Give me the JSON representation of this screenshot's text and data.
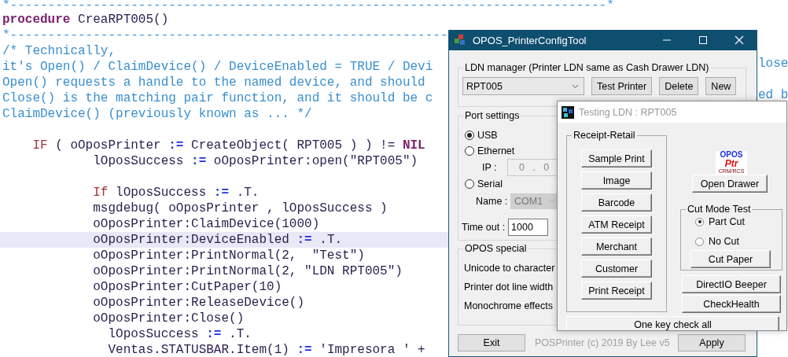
{
  "editor": {
    "lines": [
      {
        "current": false,
        "segments": [
          {
            "kind": "rule",
            "text": "*-------------------------------------------------------------------------------*"
          }
        ]
      },
      {
        "current": false,
        "segments": [
          {
            "kind": "keyword",
            "text": "procedure"
          },
          {
            "kind": "plain",
            "text": " CreaRPT005()"
          }
        ]
      },
      {
        "current": false,
        "segments": [
          {
            "kind": "rule",
            "text": "*----------------------------------------------------------"
          }
        ]
      },
      {
        "current": false,
        "segments": [
          {
            "kind": "comment",
            "text": "/* Technically,"
          }
        ]
      },
      {
        "current": false,
        "segments": [
          {
            "kind": "comment",
            "text": "it's Open() / ClaimDevice() / DeviceEnabled = TRUE / Devi"
          }
        ],
        "tail": "lose"
      },
      {
        "current": false,
        "segments": [
          {
            "kind": "comment",
            "text": "Open() requests a handle to the named device, and should"
          }
        ]
      },
      {
        "current": false,
        "segments": [
          {
            "kind": "comment",
            "text": "Close() is the matching pair function, and it should be c"
          }
        ],
        "tail": "ed b"
      },
      {
        "current": false,
        "segments": [
          {
            "kind": "comment",
            "text": "ClaimDevice() (previously known as ... */"
          }
        ]
      },
      {
        "current": false
      },
      {
        "current": false,
        "segments": [
          {
            "kind": "control",
            "text": "    IF"
          },
          {
            "kind": "plain",
            "text": " ( oOposPrinter "
          },
          {
            "kind": "operator",
            "text": ":="
          },
          {
            "kind": "plain",
            "text": " CreateObject( RPT005 ) ) != "
          },
          {
            "kind": "constant",
            "text": "NIL"
          }
        ]
      },
      {
        "current": false,
        "segments": [
          {
            "kind": "plain",
            "text": "            lOposSuccess "
          },
          {
            "kind": "operator",
            "text": ":="
          },
          {
            "kind": "plain",
            "text": " oOposPrinter:open(\"RPT005\")"
          }
        ]
      },
      {
        "current": false
      },
      {
        "current": false,
        "segments": [
          {
            "kind": "control",
            "text": "            If"
          },
          {
            "kind": "plain",
            "text": " lOposSuccess "
          },
          {
            "kind": "operator",
            "text": ":="
          },
          {
            "kind": "plain",
            "text": " .T."
          }
        ]
      },
      {
        "current": false,
        "segments": [
          {
            "kind": "plain",
            "text": "            msgdebug( oOposPrinter , lOposSuccess )"
          }
        ]
      },
      {
        "current": false,
        "segments": [
          {
            "kind": "plain",
            "text": "            oOposPrinter:ClaimDevice(1000)"
          }
        ]
      },
      {
        "current": true,
        "segments": [
          {
            "kind": "plain",
            "text": "            oOposPrinter:DeviceEnabled "
          },
          {
            "kind": "operator",
            "text": ":="
          },
          {
            "kind": "plain",
            "text": " .T."
          }
        ]
      },
      {
        "current": false,
        "segments": [
          {
            "kind": "plain",
            "text": "            oOposPrinter:PrintNormal(2,  \"Test\")"
          }
        ]
      },
      {
        "current": false,
        "segments": [
          {
            "kind": "plain",
            "text": "            oOposPrinter:PrintNormal(2, \"LDN RPT005\")"
          }
        ]
      },
      {
        "current": false,
        "segments": [
          {
            "kind": "plain",
            "text": "            oOposPrinter:CutPaper(10)"
          }
        ]
      },
      {
        "current": false,
        "segments": [
          {
            "kind": "plain",
            "text": "            oOposPrinter:ReleaseDevice()"
          }
        ]
      },
      {
        "current": false,
        "segments": [
          {
            "kind": "plain",
            "text": "            oOposPrinter:Close()"
          }
        ]
      },
      {
        "current": false,
        "segments": [
          {
            "kind": "plain",
            "text": "              lOposSuccess "
          },
          {
            "kind": "operator",
            "text": ":="
          },
          {
            "kind": "plain",
            "text": " .T."
          }
        ]
      },
      {
        "current": false,
        "segments": [
          {
            "kind": "plain",
            "text": "              Ventas.STATUSBAR.Item(1) "
          },
          {
            "kind": "operator",
            "text": ":="
          },
          {
            "kind": "plain",
            "text": " 'Impresora ' +"
          }
        ]
      }
    ]
  },
  "config_window": {
    "title": "OPOS_PrinterConfigTool",
    "ldn_group": {
      "legend": "LDN manager (Printer LDN same as Cash Drawer LDN)",
      "combo": "RPT005",
      "buttons": [
        "Test Printer",
        "Delete",
        "New"
      ]
    },
    "port_group": {
      "legend": "Port settings",
      "ports": [
        {
          "label": "USB",
          "selected": true
        },
        {
          "label": "Ethernet",
          "selected": false
        },
        {
          "label": "Serial",
          "selected": false
        }
      ],
      "ip_label": "IP :",
      "ip_value": "0   .   0",
      "name_label": "Name :",
      "name_combo": {
        "value": "COM1",
        "disabled": true
      },
      "timeout_label": "Time out :",
      "timeout_value": "1000"
    },
    "opos_group": {
      "legend": "OPOS special",
      "rows": [
        "Unicode to character",
        "Printer dot line width",
        "Monochrome effects"
      ]
    },
    "exit_button": "Exit",
    "footer": "POSPrinter (c) 2019 By Lee  v5",
    "apply_button": "Apply"
  },
  "test_window": {
    "title": "Testing LDN : RPT005",
    "receipt_group": {
      "legend": "Receipt-Retail",
      "buttons": [
        "Sample Print",
        "Image",
        "Barcode",
        "ATM Receipt",
        "Merchant",
        "Customer",
        "Print Receipt"
      ]
    },
    "logo": {
      "top": "OPOS",
      "middle": "Ptr",
      "bottom": "CRM/RCS"
    },
    "open_drawer": "Open Drawer",
    "cut_group": {
      "legend": "Cut Mode Test",
      "modes": [
        {
          "label": "Part Cut",
          "selected": true
        },
        {
          "label": "No Cut",
          "selected": false
        }
      ],
      "button": "Cut Paper"
    },
    "buttons": [
      "DirectIO  Beeper",
      "CheckHealth"
    ],
    "check_all": "One key check all"
  }
}
